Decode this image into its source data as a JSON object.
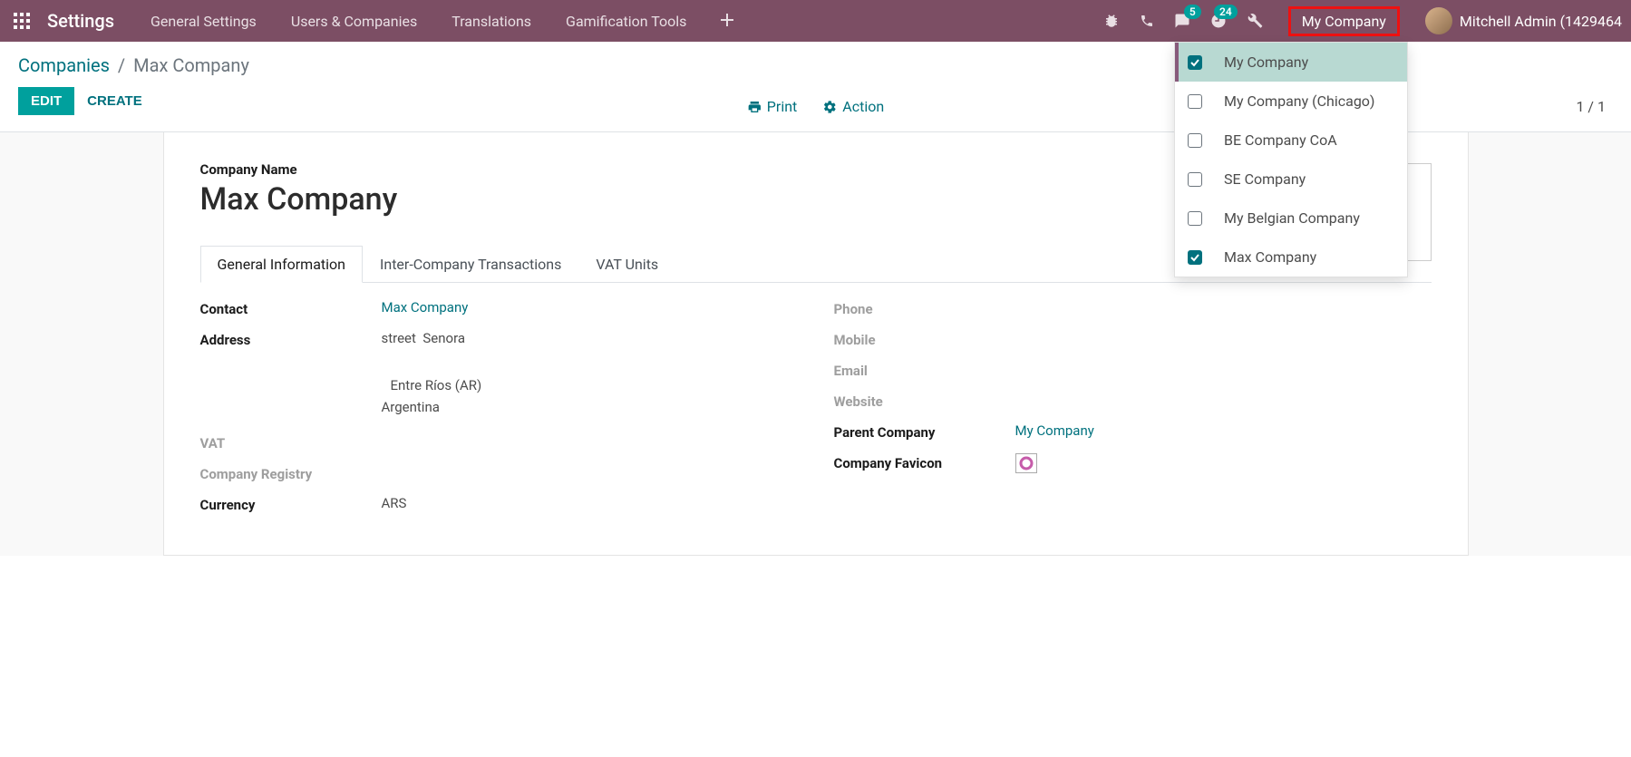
{
  "navbar": {
    "title": "Settings",
    "menu": [
      "General Settings",
      "Users & Companies",
      "Translations",
      "Gamification Tools"
    ],
    "messages_badge": "5",
    "activities_badge": "24",
    "company_switch_label": "My Company",
    "user_name": "Mitchell Admin (1429464"
  },
  "breadcrumb": {
    "parent": "Companies",
    "current": "Max Company"
  },
  "buttons": {
    "edit": "EDIT",
    "create": "CREATE",
    "print": "Print",
    "action": "Action"
  },
  "pager": "1 / 1",
  "company_dropdown": [
    {
      "label": "My Company",
      "checked": true,
      "active": true
    },
    {
      "label": "My Company (Chicago)",
      "checked": false,
      "active": false
    },
    {
      "label": "BE Company CoA",
      "checked": false,
      "active": false
    },
    {
      "label": "SE Company",
      "checked": false,
      "active": false
    },
    {
      "label": "My Belgian Company",
      "checked": false,
      "active": false
    },
    {
      "label": "Max Company",
      "checked": true,
      "active": false
    }
  ],
  "form": {
    "company_name_label": "Company Name",
    "company_name": "Max Company",
    "tabs": [
      "General Information",
      "Inter-Company Transactions",
      "VAT Units"
    ],
    "fields_left": {
      "contact_label": "Contact",
      "contact_value": "Max Company",
      "address_label": "Address",
      "address_street": "street",
      "address_street2": "Senora",
      "address_state": "Entre Ríos (AR)",
      "address_country": "Argentina",
      "vat_label": "VAT",
      "registry_label": "Company Registry",
      "currency_label": "Currency",
      "currency_value": "ARS"
    },
    "fields_right": {
      "phone_label": "Phone",
      "mobile_label": "Mobile",
      "email_label": "Email",
      "website_label": "Website",
      "parent_label": "Parent Company",
      "parent_value": "My Company",
      "favicon_label": "Company Favicon"
    }
  }
}
